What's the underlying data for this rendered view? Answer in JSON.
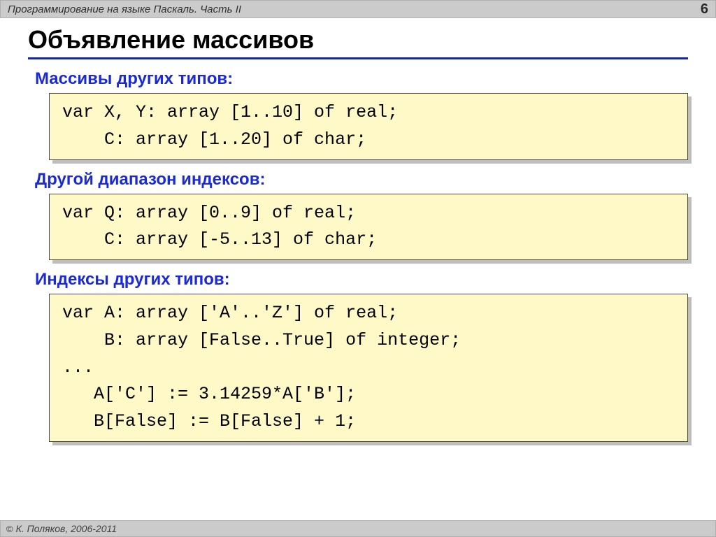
{
  "header": {
    "breadcrumb": "Программирование на языке Паскаль. Часть II",
    "page_number": "6"
  },
  "title": "Объявление массивов",
  "sections": [
    {
      "label": "Массивы других типов:",
      "code": "var X, Y: array [1..10] of real;\n    C: array [1..20] of char;"
    },
    {
      "label": "Другой диапазон индексов:",
      "code": "var Q: array [0..9] of real;\n    C: array [-5..13] of char;"
    },
    {
      "label": "Индексы других типов:",
      "code": "var A: array ['A'..'Z'] of real;\n    B: array [False..True] of integer;\n...\n   A['C'] := 3.14259*A['B'];\n   B[False] := B[False] + 1;"
    }
  ],
  "footer": {
    "copyright_symbol": "©",
    "copyright_text": "К. Поляков, 2006-2011"
  }
}
